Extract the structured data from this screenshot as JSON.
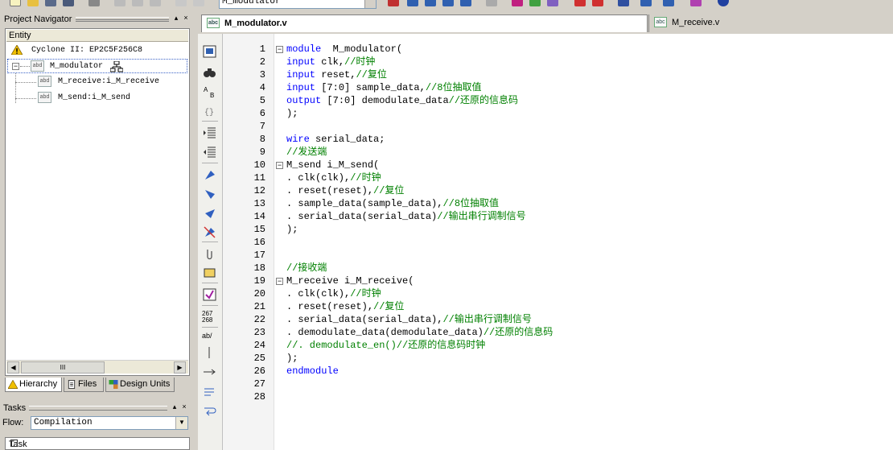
{
  "toolbar": {
    "combo_value": "M_modulator"
  },
  "navigator": {
    "title": "Project Navigator",
    "pin": "▴",
    "close": "×",
    "column": "Entity",
    "device": "Cyclone II: EP2C5F256C8",
    "top": "M_modulator",
    "children": [
      "M_receive:i_M_receive",
      "M_send:i_M_send"
    ],
    "scroll_grip": "III",
    "tabs": [
      "Hierarchy",
      "Files",
      "Design Units"
    ]
  },
  "tasks": {
    "title": "Tasks",
    "flow_label": "Flow:",
    "flow_value": "Compilation",
    "first_column": "Task"
  },
  "editor": {
    "tabs": [
      "M_modulator.v",
      "M_receive.v"
    ],
    "side_numbers": [
      "267",
      "268"
    ],
    "side_abbr": "ab/",
    "lines": [
      {
        "n": "1",
        "fold": "−",
        "code": [
          [
            "kw",
            "module"
          ],
          [
            "",
            "  M_modulator("
          ]
        ]
      },
      {
        "n": "2",
        "code": [
          [
            "kw",
            "input"
          ],
          [
            "",
            " clk,"
          ],
          [
            "cm",
            "//时钟"
          ]
        ]
      },
      {
        "n": "3",
        "code": [
          [
            "kw",
            "input"
          ],
          [
            "",
            " reset,"
          ],
          [
            "cm",
            "//复位"
          ]
        ]
      },
      {
        "n": "4",
        "code": [
          [
            "kw",
            "input"
          ],
          [
            "",
            " [7:0] sample_data,"
          ],
          [
            "cm",
            "//8位抽取值"
          ]
        ]
      },
      {
        "n": "5",
        "code": [
          [
            "kw",
            "output"
          ],
          [
            "",
            " [7:0] demodulate_data"
          ],
          [
            "cm",
            "//还原的信息码"
          ]
        ]
      },
      {
        "n": "6",
        "code": [
          [
            "",
            ");"
          ]
        ]
      },
      {
        "n": "7",
        "code": []
      },
      {
        "n": "8",
        "code": [
          [
            "kw",
            "wire"
          ],
          [
            "",
            " serial_data;"
          ]
        ]
      },
      {
        "n": "9",
        "code": [
          [
            "cm",
            "//发送端"
          ]
        ]
      },
      {
        "n": "10",
        "fold": "−",
        "code": [
          [
            "",
            "M_send i_M_send("
          ]
        ]
      },
      {
        "n": "11",
        "code": [
          [
            "",
            ". clk(clk),"
          ],
          [
            "cm",
            "//时钟"
          ]
        ]
      },
      {
        "n": "12",
        "code": [
          [
            "",
            ". reset(reset),"
          ],
          [
            "cm",
            "//复位"
          ]
        ]
      },
      {
        "n": "13",
        "code": [
          [
            "",
            ". sample_data(sample_data),"
          ],
          [
            "cm",
            "//8位抽取值"
          ]
        ]
      },
      {
        "n": "14",
        "code": [
          [
            "",
            ". serial_data(serial_data)"
          ],
          [
            "cm",
            "//输出串行调制信号"
          ]
        ]
      },
      {
        "n": "15",
        "code": [
          [
            "",
            ");"
          ]
        ]
      },
      {
        "n": "16",
        "code": []
      },
      {
        "n": "17",
        "code": []
      },
      {
        "n": "18",
        "code": [
          [
            "cm",
            "//接收端"
          ]
        ]
      },
      {
        "n": "19",
        "fold": "−",
        "code": [
          [
            "",
            "M_receive i_M_receive("
          ]
        ]
      },
      {
        "n": "20",
        "code": [
          [
            "",
            ". clk(clk),"
          ],
          [
            "cm",
            "//时钟"
          ]
        ]
      },
      {
        "n": "21",
        "code": [
          [
            "",
            ". reset(reset),"
          ],
          [
            "cm",
            "//复位"
          ]
        ]
      },
      {
        "n": "22",
        "code": [
          [
            "",
            ". serial_data(serial_data),"
          ],
          [
            "cm",
            "//输出串行调制信号"
          ]
        ]
      },
      {
        "n": "23",
        "code": [
          [
            "",
            ". demodulate_data(demodulate_data)"
          ],
          [
            "cm",
            "//还原的信息码"
          ]
        ]
      },
      {
        "n": "24",
        "code": [
          [
            "cm",
            "//. demodulate_en()//还原的信息码时钟"
          ]
        ]
      },
      {
        "n": "25",
        "code": [
          [
            "",
            ");"
          ]
        ]
      },
      {
        "n": "26",
        "code": [
          [
            "kw",
            "endmodule"
          ]
        ]
      },
      {
        "n": "27",
        "code": []
      },
      {
        "n": "28",
        "code": []
      }
    ]
  },
  "colors": {
    "keyword": "#0000ff",
    "comment": "#008000",
    "chrome": "#d4d0c8"
  }
}
